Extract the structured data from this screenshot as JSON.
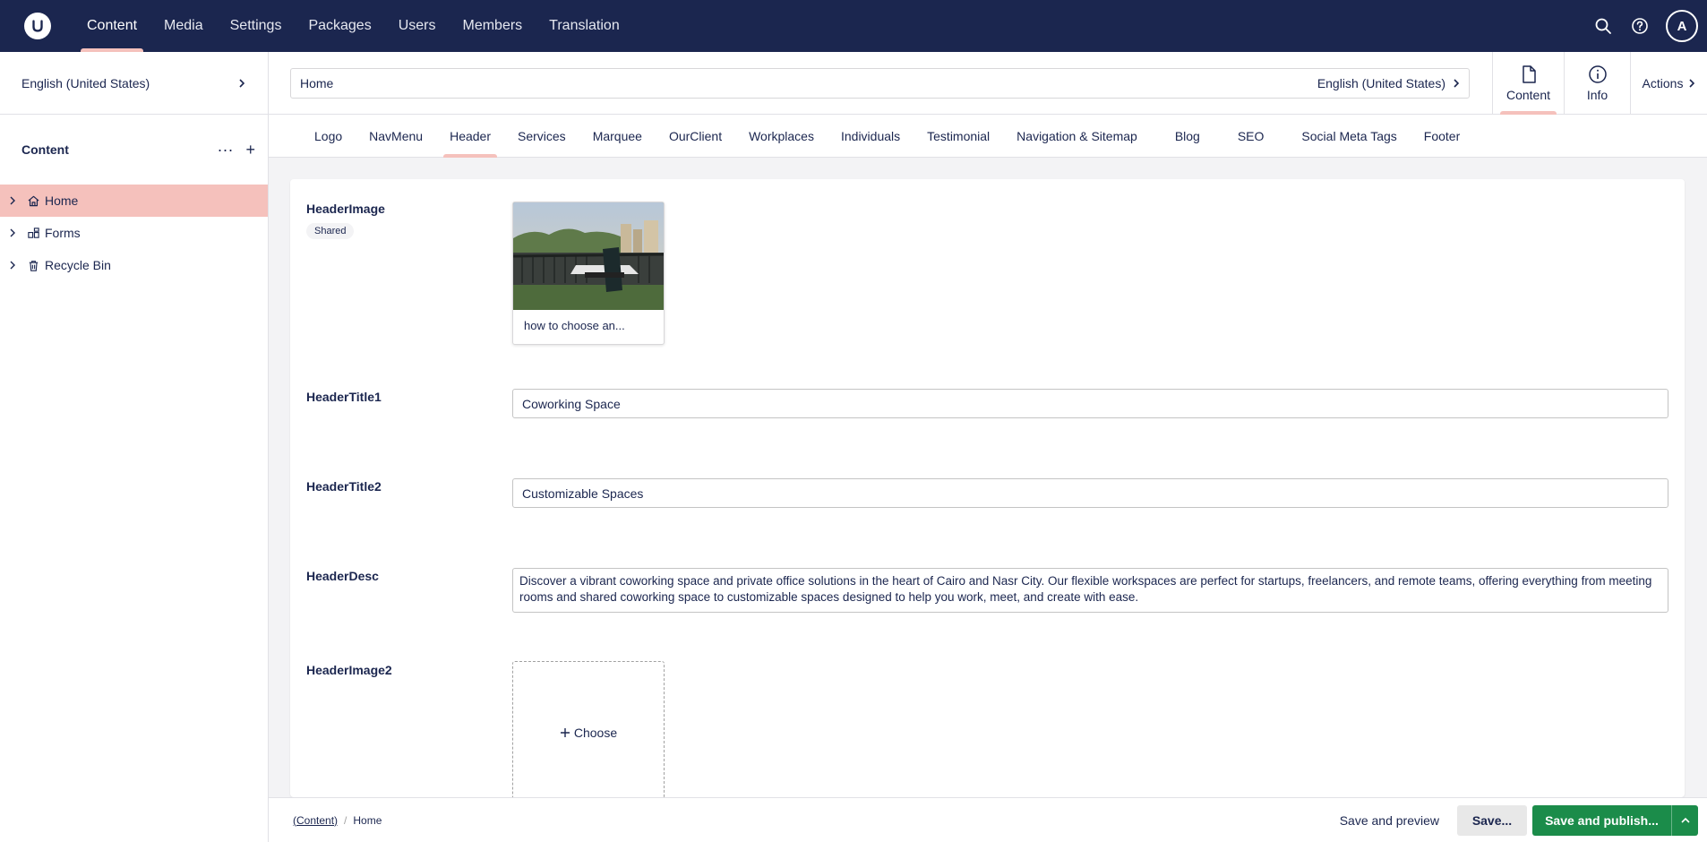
{
  "topnav": {
    "items": [
      "Content",
      "Media",
      "Settings",
      "Packages",
      "Users",
      "Members",
      "Translation"
    ],
    "active": "Content",
    "avatar_initial": "A"
  },
  "sidebar": {
    "language": "English (United States)",
    "section_title": "Content",
    "tree": [
      {
        "label": "Home",
        "icon": "home-icon",
        "active": true
      },
      {
        "label": "Forms",
        "icon": "forms-icon",
        "active": false
      },
      {
        "label": "Recycle Bin",
        "icon": "trash-icon",
        "active": false
      }
    ]
  },
  "header": {
    "name_value": "Home",
    "variant": "English (United States)",
    "apps": {
      "content": "Content",
      "info": "Info",
      "actions": "Actions"
    }
  },
  "tabs": [
    "Logo",
    "NavMenu",
    "Header",
    "Services",
    "Marquee",
    "OurClient",
    "Workplaces",
    "Individuals",
    "Testimonial",
    "Navigation & Sitemap",
    "Blog",
    "SEO",
    "Social Meta Tags",
    "Footer"
  ],
  "active_tab": "Header",
  "properties": {
    "header_image": {
      "label": "HeaderImage",
      "badge": "Shared",
      "media_caption": "how to choose an..."
    },
    "header_title1": {
      "label": "HeaderTitle1",
      "value": "Coworking Space"
    },
    "header_title2": {
      "label": "HeaderTitle2",
      "value": "Customizable Spaces"
    },
    "header_desc": {
      "label": "HeaderDesc",
      "value": "Discover a vibrant coworking space and private office solutions in the heart of Cairo and Nasr City. Our flexible workspaces are perfect for startups, freelancers, and remote teams, offering everything from meeting rooms and shared coworking space to customizable spaces designed to help you work, meet, and create with ease."
    },
    "header_image2": {
      "label": "HeaderImage2",
      "choose_label": "Choose"
    }
  },
  "footer": {
    "breadcrumb": [
      "(Content)",
      "Home"
    ],
    "save_preview": "Save and preview",
    "save": "Save...",
    "save_publish": "Save and publish..."
  },
  "colors": {
    "topbar": "#1b264f",
    "accent": "#f5c1bc",
    "publish": "#1b8c4a"
  }
}
